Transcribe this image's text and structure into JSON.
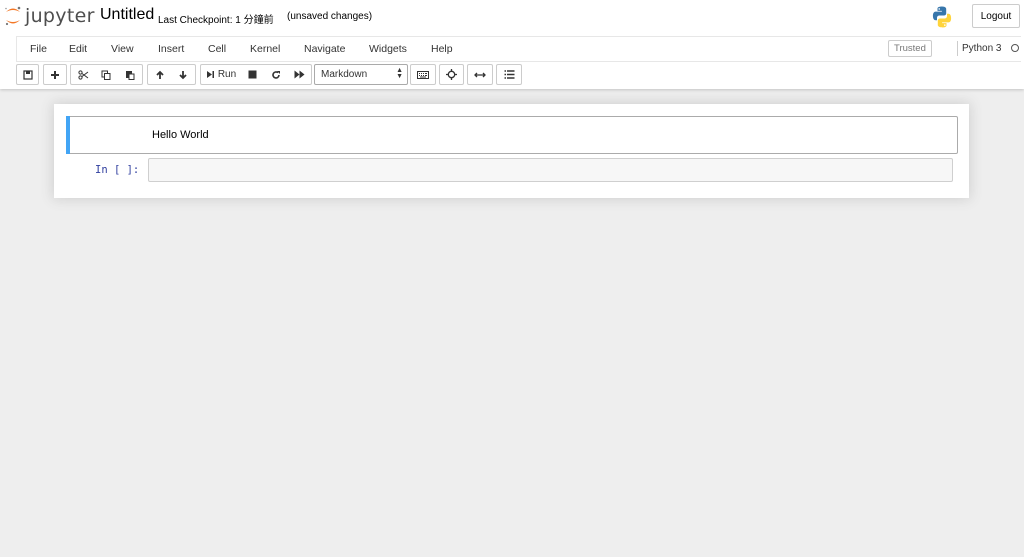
{
  "header": {
    "logo_text": "jupyter",
    "notebook_name": "Untitled",
    "checkpoint": "Last Checkpoint: 1 分鐘前",
    "autosave_status": "(unsaved changes)",
    "logout_label": "Logout"
  },
  "menubar": {
    "items": [
      "File",
      "Edit",
      "View",
      "Insert",
      "Cell",
      "Kernel",
      "Navigate",
      "Widgets",
      "Help"
    ],
    "trusted_label": "Trusted",
    "kernel_name": "Python 3"
  },
  "toolbar": {
    "run_label": "Run",
    "cell_type": "Markdown",
    "buttons": [
      "save-icon",
      "plus-icon",
      "cut-icon",
      "copy-icon",
      "paste-icon",
      "arrow-up-icon",
      "arrow-down-icon",
      "run-icon",
      "stop-icon",
      "restart-icon",
      "fast-forward-icon",
      "keyboard-icon",
      "crosshair-icon",
      "arrows-h-icon",
      "list-icon"
    ]
  },
  "notebook": {
    "cells": [
      {
        "type": "markdown",
        "text": "Hello World"
      },
      {
        "type": "code",
        "prompt": "In [ ]:",
        "source": ""
      }
    ]
  },
  "colors": {
    "selected_cell_bar": "#42a5f5",
    "prompt": "#303f9f",
    "logo_orange": "#f37726",
    "background": "#eeeeee"
  }
}
